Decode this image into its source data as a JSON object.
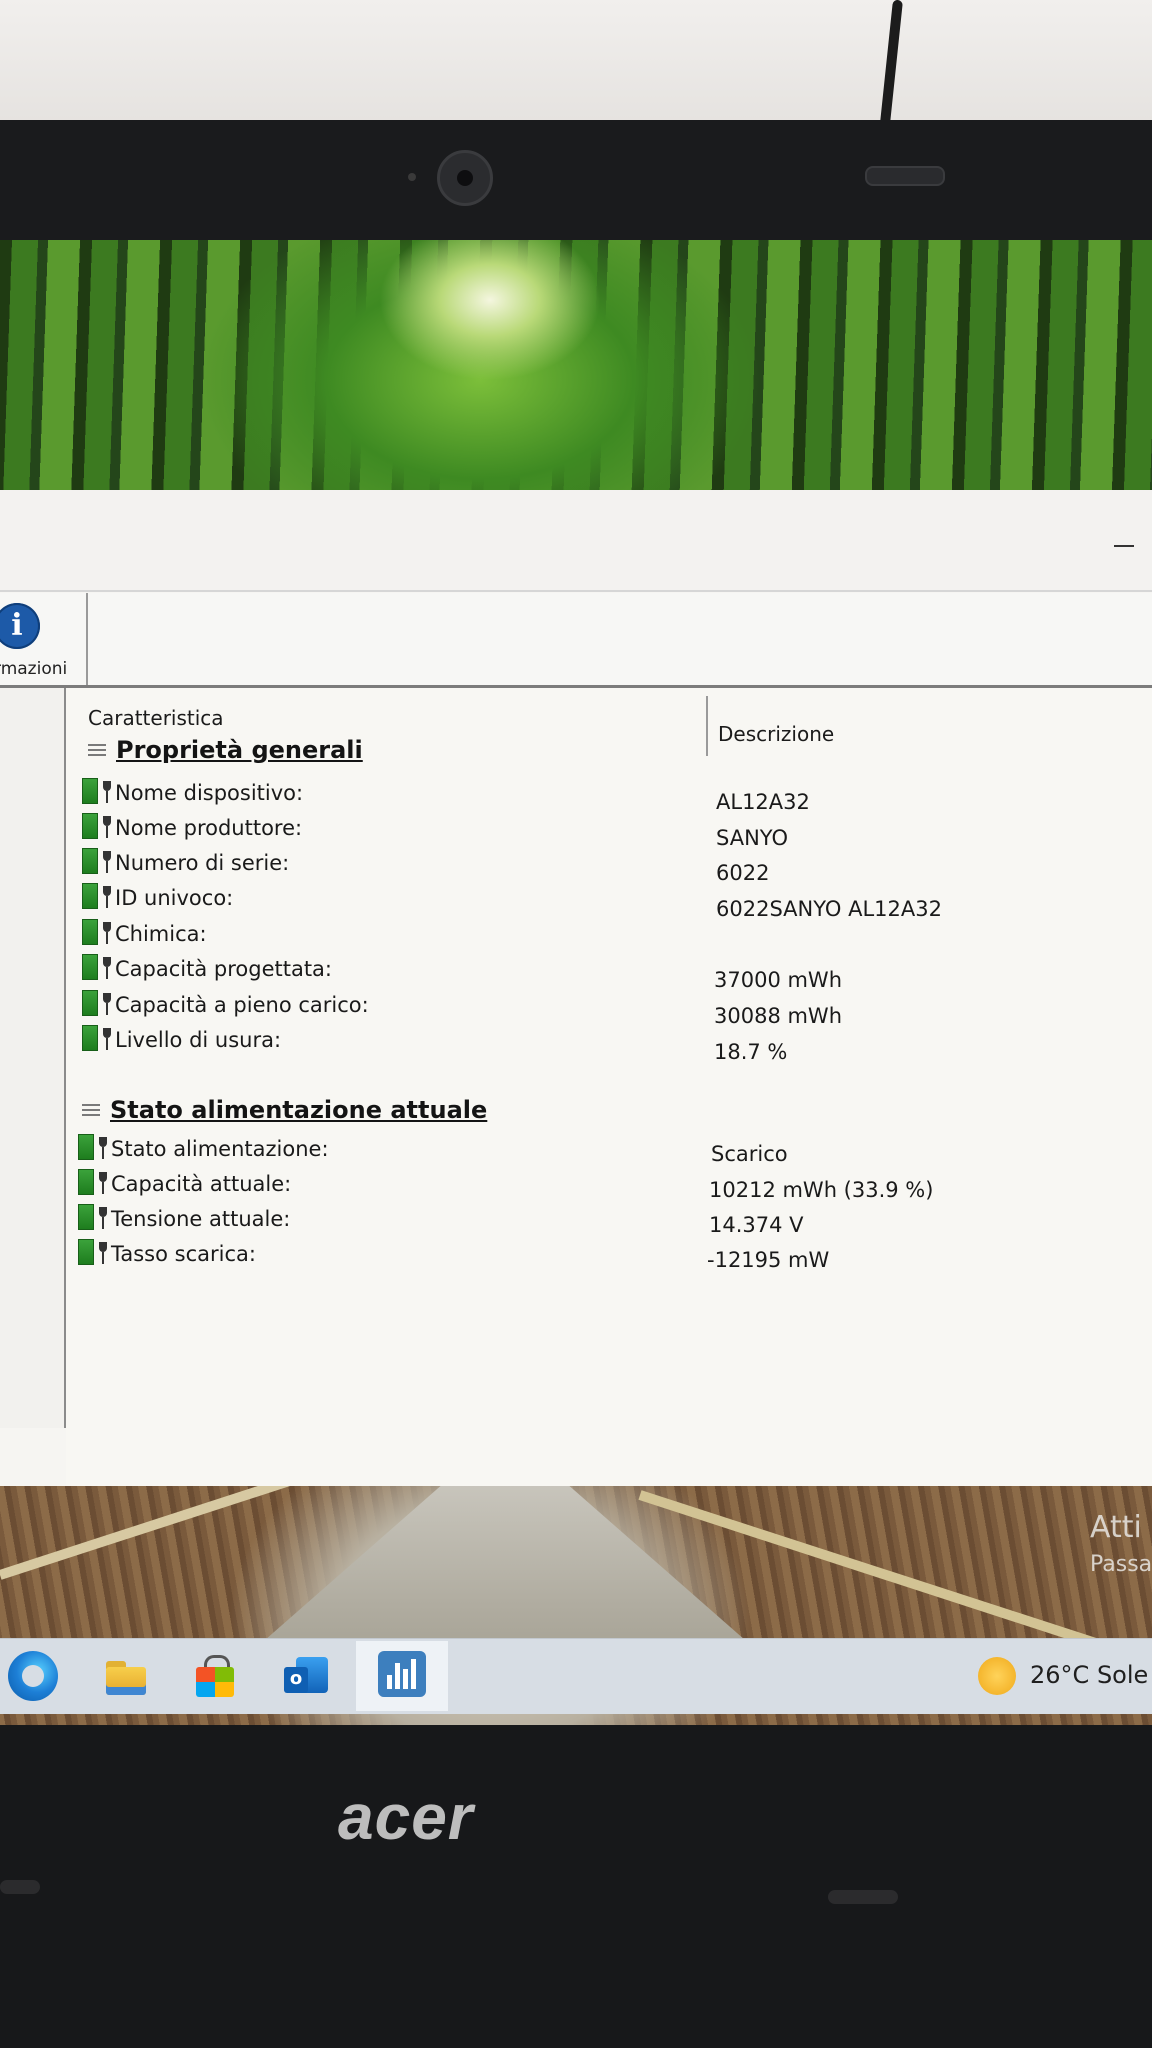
{
  "environment": {
    "laptop_brand": "acer"
  },
  "app": {
    "toolbar": {
      "info_label": "rmazioni",
      "info_icon": "i"
    },
    "table": {
      "col_feature": "Caratteristica",
      "col_description": "Descrizione",
      "groups": [
        {
          "title": "Proprietà generali",
          "rows": [
            {
              "label": "Nome dispositivo:",
              "value": "AL12A32"
            },
            {
              "label": "Nome produttore:",
              "value": "SANYO"
            },
            {
              "label": "Numero di serie:",
              "value": "6022"
            },
            {
              "label": "ID univoco:",
              "value": "6022SANYO AL12A32"
            },
            {
              "label": "Chimica:",
              "value": ""
            },
            {
              "label": "Capacità progettata:",
              "value": "37000 mWh"
            },
            {
              "label": "Capacità a pieno carico:",
              "value": "30088 mWh"
            },
            {
              "label": "Livello di usura:",
              "value": "18.7 %"
            }
          ]
        },
        {
          "title": "Stato alimentazione attuale",
          "rows": [
            {
              "label": "Stato alimentazione:",
              "value": "Scarico"
            },
            {
              "label": "Capacità attuale:",
              "value": "10212 mWh (33.9 %)"
            },
            {
              "label": "Tensione attuale:",
              "value": "14.374 V"
            },
            {
              "label": "Tasso scarica:",
              "value": "-12195 mW"
            }
          ]
        }
      ]
    }
  },
  "desktop": {
    "watermark_line1": "Atti",
    "watermark_line2": "Passa"
  },
  "taskbar": {
    "icons": [
      "edge-icon",
      "folder-icon",
      "store-icon",
      "outlook-icon",
      "bars-app-icon"
    ],
    "weather_temp": "26°C",
    "weather_text": "Sole"
  },
  "colors": {
    "battery_green": "#2a8f2a",
    "info_blue": "#1d5aa8",
    "sun": "#f0a91a"
  }
}
